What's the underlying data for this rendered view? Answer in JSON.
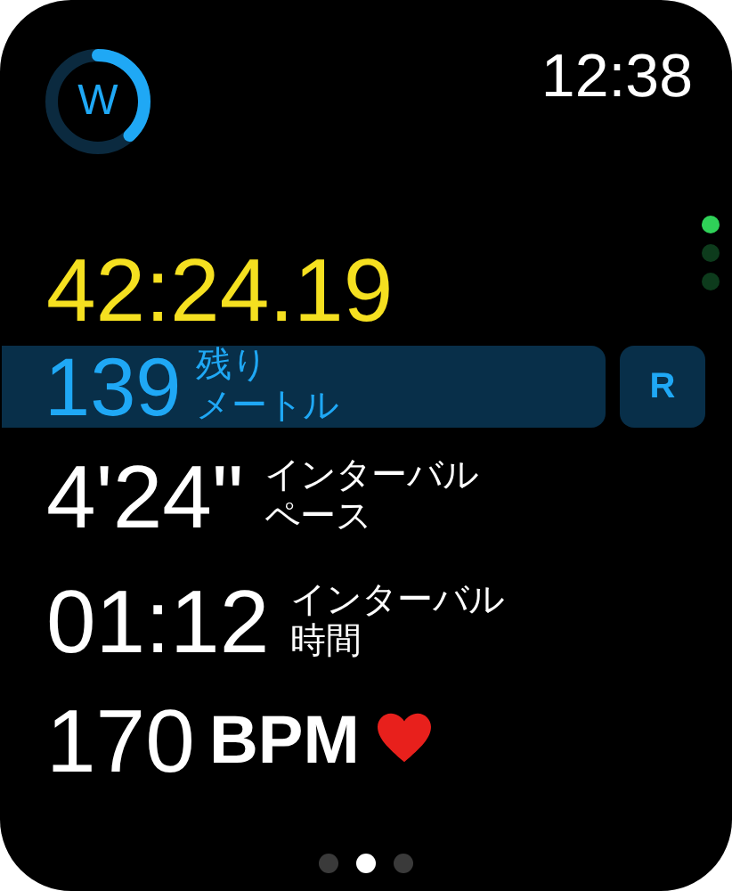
{
  "workout_ring": {
    "label": "W"
  },
  "time": "12:38",
  "side_pages": [
    {
      "selected": true
    },
    {
      "selected": false
    },
    {
      "selected": false
    }
  ],
  "elapsed": "42:24.19",
  "metrics": [
    {
      "kind": "highlight",
      "value": "139",
      "label_lines": [
        "残り",
        "メートル"
      ],
      "button": "R"
    },
    {
      "kind": "plain",
      "value": "4'24\"",
      "label_lines": [
        "インターバル",
        "ペース"
      ]
    },
    {
      "kind": "plain",
      "value": "01:12",
      "label_lines": [
        "インターバル",
        "時間"
      ]
    }
  ],
  "heart_rate": {
    "value": "170",
    "unit": "BPM"
  },
  "pages": [
    {
      "selected": false
    },
    {
      "selected": true
    },
    {
      "selected": false
    }
  ]
}
